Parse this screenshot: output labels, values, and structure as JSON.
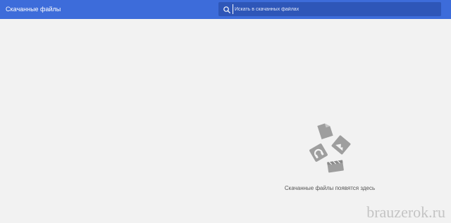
{
  "header": {
    "title": "Скачанные файлы",
    "background_color": "#3d6cda",
    "search": {
      "placeholder": "Искать в скачанных файлах",
      "value": "",
      "icon": "search-icon"
    }
  },
  "main": {
    "empty_state": {
      "illustration_icons": [
        "document-icon",
        "image-icon",
        "audio-icon",
        "video-icon"
      ],
      "message": "Скачанные файлы появятся здесь"
    }
  },
  "watermark": {
    "text": "brauzerok.ru"
  }
}
